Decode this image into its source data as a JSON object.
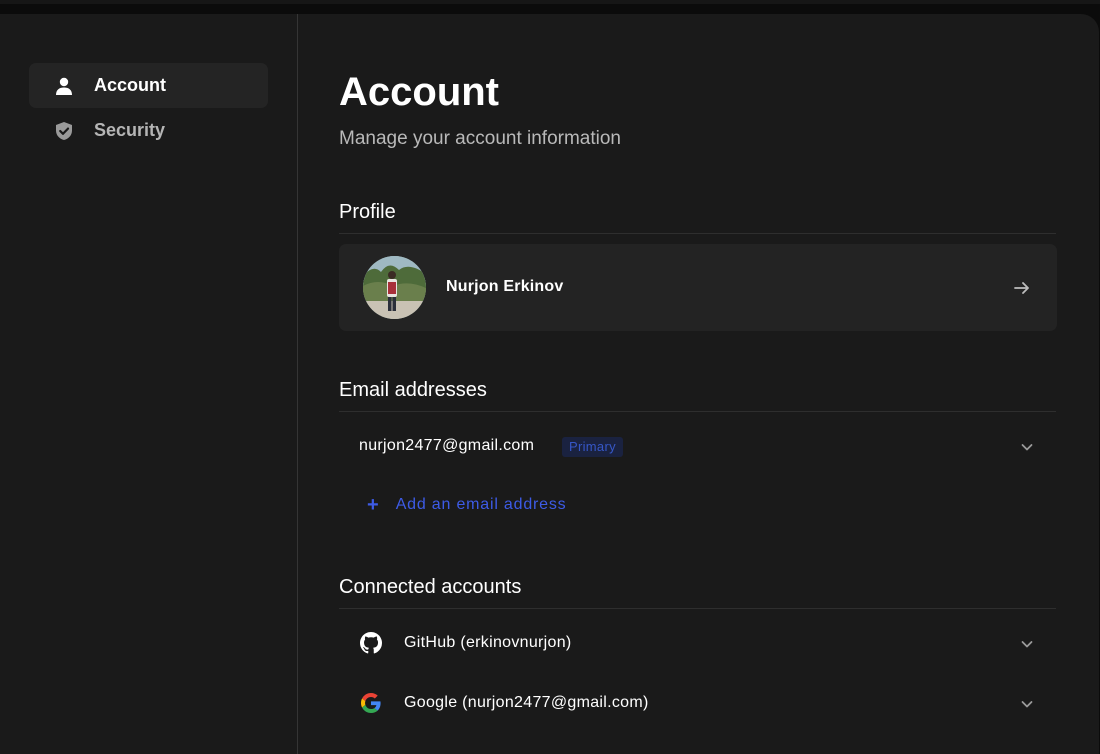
{
  "sidebar": {
    "items": [
      {
        "label": "Account",
        "icon": "user-icon",
        "active": true
      },
      {
        "label": "Security",
        "icon": "shield-check-icon",
        "active": false
      }
    ]
  },
  "header": {
    "title": "Account",
    "subtitle": "Manage your account information"
  },
  "profile": {
    "section_title": "Profile",
    "name": "Nurjon Erkinov"
  },
  "emails": {
    "section_title": "Email addresses",
    "items": [
      {
        "address": "nurjon2477@gmail.com",
        "badge": "Primary"
      }
    ],
    "add_label": "Add an email address",
    "add_icon": "+"
  },
  "connected": {
    "section_title": "Connected accounts",
    "items": [
      {
        "label": "GitHub (erkinovnurjon)",
        "icon": "github-icon"
      },
      {
        "label": "Google (nurjon2477@gmail.com)",
        "icon": "google-icon"
      }
    ]
  },
  "colors": {
    "background": "#1a1a1a",
    "accent": "#3d5be6",
    "muted": "#b9b9b9"
  }
}
